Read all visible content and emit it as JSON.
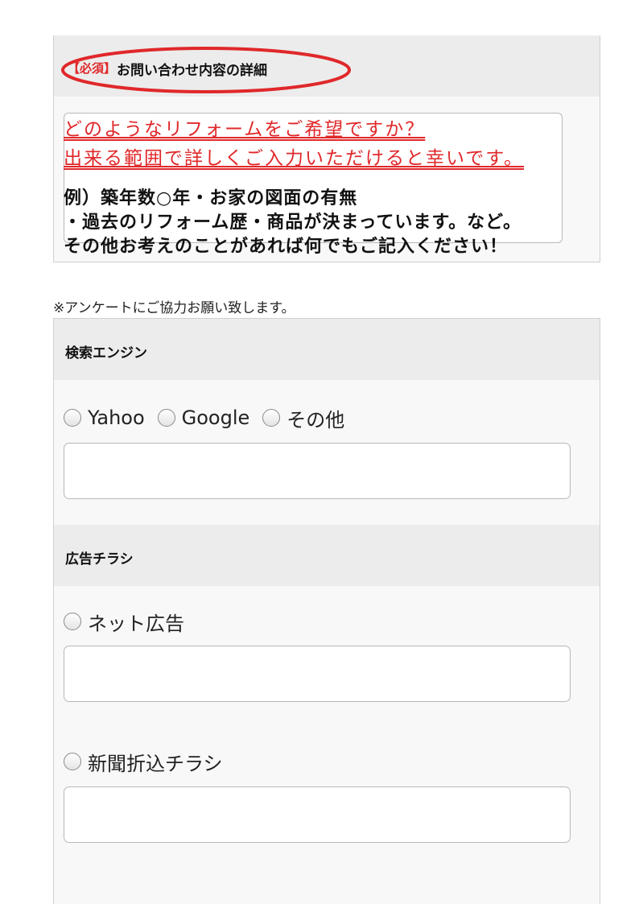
{
  "detail": {
    "required_tag": "【必須】",
    "title": "お問い合わせ内容の詳細",
    "placeholder_lines_red": [
      "どのようなリフォームをご希望ですか？",
      "出来る範囲で詳しくご入力いただけると幸いです。"
    ],
    "placeholder_lines_black": [
      "例）築年数○年・お家の図面の有無",
      "・過去のリフォーム歴・商品が決まっています。など。",
      "その他お考えのことがあれば何でもご記入ください！"
    ],
    "highlight_color": "#e0282a"
  },
  "survey": {
    "note": "※アンケートにご協力お願い致します。",
    "search_engine": {
      "title": "検索エンジン",
      "options": [
        "Yahoo",
        "Google",
        "その他"
      ]
    },
    "flyer": {
      "title": "広告チラシ",
      "options": [
        "ネット広告",
        "新聞折込チラシ"
      ]
    }
  },
  "colors": {
    "accent_red": "#e0282a",
    "header_bg": "#ececec",
    "panel_bg": "#f8f8f8"
  }
}
